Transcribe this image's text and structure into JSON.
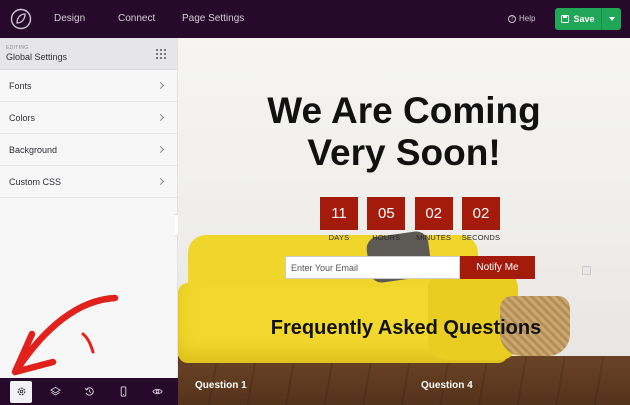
{
  "topbar": {
    "logo_icon": "leaf-logo-icon",
    "nav": [
      "Design",
      "Connect",
      "Page Settings"
    ],
    "help_label": "Help",
    "save_label": "Save"
  },
  "sidebar": {
    "editing_label": "EDITING",
    "title": "Global Settings",
    "items": [
      {
        "label": "Fonts"
      },
      {
        "label": "Colors"
      },
      {
        "label": "Background"
      },
      {
        "label": "Custom CSS"
      }
    ]
  },
  "bottombar": {
    "buttons": [
      {
        "icon": "gear-icon",
        "active": true
      },
      {
        "icon": "layers-icon",
        "active": false
      },
      {
        "icon": "history-icon",
        "active": false
      },
      {
        "icon": "mobile-preview-icon",
        "active": false
      },
      {
        "icon": "eye-preview-icon",
        "active": false
      }
    ]
  },
  "preview": {
    "headline_line1": "We Are Coming",
    "headline_line2": "Very Soon!",
    "countdown": [
      {
        "value": "11",
        "label": "DAYS"
      },
      {
        "value": "05",
        "label": "HOURS"
      },
      {
        "value": "02",
        "label": "MINUTES"
      },
      {
        "value": "02",
        "label": "SECONDS"
      }
    ],
    "email_placeholder": "Enter Your Email",
    "notify_label": "Notify Me",
    "faq_title": "Frequently Asked Questions",
    "questions": [
      "Question 1",
      "Question 4"
    ]
  },
  "colors": {
    "topbar_bg": "#26092b",
    "save_green": "#1fa657",
    "accent_red": "#a41a0b",
    "annotation_arrow": "#e3211c"
  }
}
